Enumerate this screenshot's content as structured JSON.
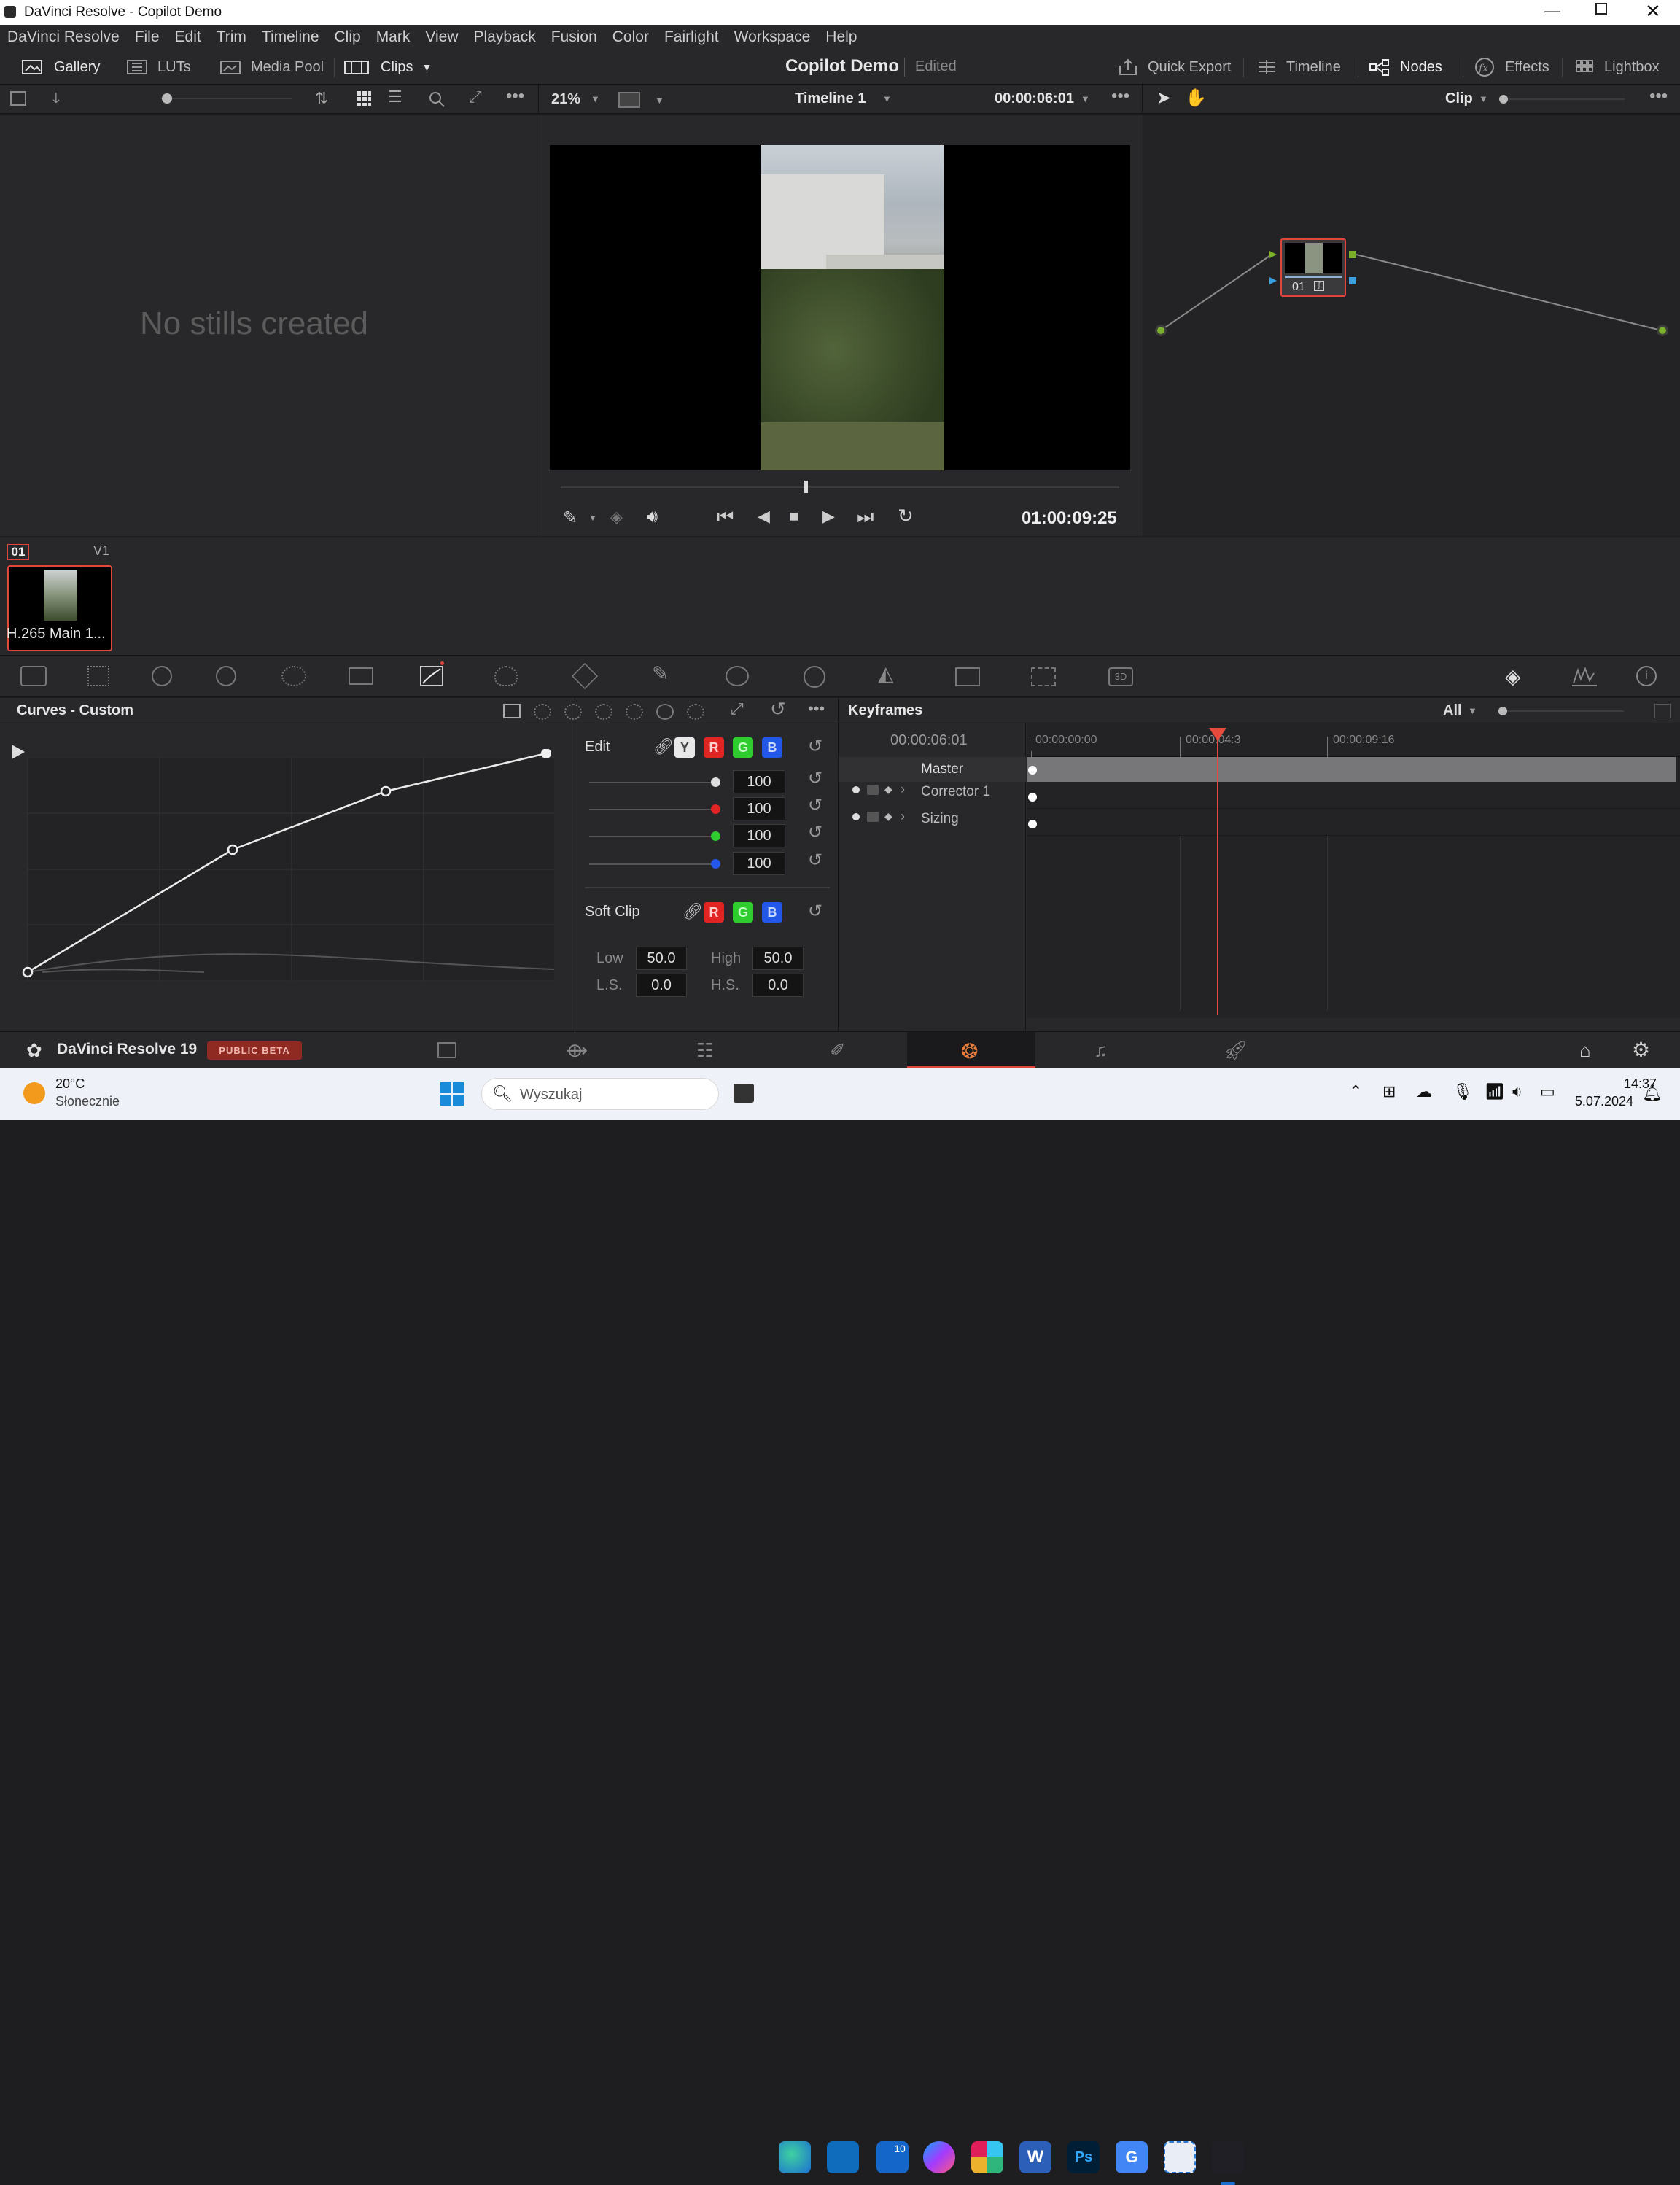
{
  "window": {
    "title": "DaVinci Resolve - Copilot Demo"
  },
  "menu": [
    "DaVinci Resolve",
    "File",
    "Edit",
    "Trim",
    "Timeline",
    "Clip",
    "Mark",
    "View",
    "Playback",
    "Fusion",
    "Color",
    "Fairlight",
    "Workspace",
    "Help"
  ],
  "modes": {
    "gallery": "Gallery",
    "luts": "LUTs",
    "media_pool": "Media Pool",
    "clips": "Clips",
    "project": "Copilot Demo",
    "status": "Edited",
    "quick_export": "Quick Export",
    "timeline": "Timeline",
    "nodes": "Nodes",
    "effects": "Effects",
    "lightbox": "Lightbox"
  },
  "viewer": {
    "zoom": "21%",
    "timeline_name": "Timeline 1",
    "timecode": "00:00:06:01",
    "playback_tc": "01:00:09:25"
  },
  "nodes": {
    "mode": "Clip",
    "node_label": "01"
  },
  "gallery": {
    "empty": "No stills created"
  },
  "clip": {
    "index": "01",
    "track": "V1",
    "name": "H.265 Main 1..."
  },
  "curves": {
    "title": "Curves - Custom",
    "edit": "Edit",
    "y": "Y",
    "r": "R",
    "g": "G",
    "b": "B",
    "values": [
      "100",
      "100",
      "100",
      "100"
    ],
    "soft_clip": "Soft Clip",
    "low_label": "Low",
    "low": "50.0",
    "high_label": "High",
    "high": "50.0",
    "ls_label": "L.S.",
    "ls": "0.0",
    "hs_label": "H.S.",
    "hs": "0.0"
  },
  "keyframes": {
    "title": "Keyframes",
    "filter": "All",
    "current": "00:00:06:01",
    "ruler": [
      "00:00:00:00",
      "00:00:04:3",
      "00:00:09:16"
    ],
    "tracks": [
      "Master",
      "Corrector 1",
      "Sizing"
    ]
  },
  "footer": {
    "app": "DaVinci Resolve 19",
    "badge": "PUBLIC BETA"
  },
  "taskbar": {
    "temp": "20°C",
    "weather": "Słonecznie",
    "search": "Wyszukaj",
    "time": "14:37",
    "date": "5.07.2024",
    "badge": "10"
  },
  "colors": {
    "accent_red": "#e0463a",
    "playhead": "#e54b3c"
  }
}
